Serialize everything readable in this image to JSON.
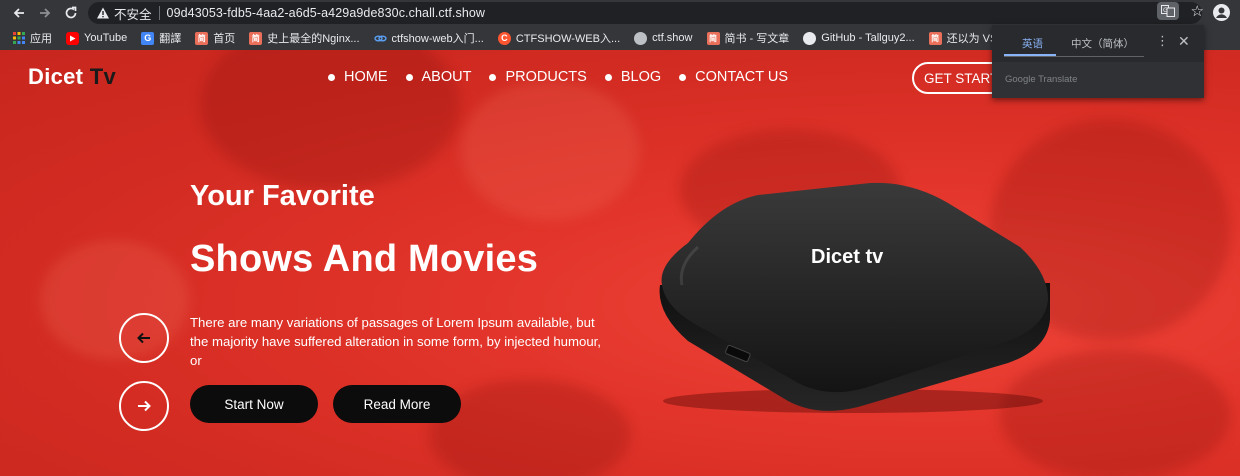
{
  "browser": {
    "insecure_label": "不安全",
    "url": "09d43053-fdb5-4aa2-a6d5-a429a9de830c.chall.ctf.show",
    "bookmarks": [
      {
        "label": "应用",
        "icon": "apps-grid-icon",
        "color": "#4285f4"
      },
      {
        "label": "YouTube",
        "icon": "youtube-icon",
        "color": "#ff0000"
      },
      {
        "label": "翻譯",
        "icon": "translate-icon",
        "color": "#4285f4"
      },
      {
        "label": "首页",
        "icon": "jianshu-icon",
        "color": "#ea6f5a"
      },
      {
        "label": "史上最全的Nginx...",
        "icon": "jianshu-icon",
        "color": "#ea6f5a"
      },
      {
        "label": "ctfshow-web入门...",
        "icon": "link-icon",
        "color": "#5aa0f5"
      },
      {
        "label": "CTFSHOW-WEB入...",
        "icon": "csdn-icon",
        "color": "#fc5531"
      },
      {
        "label": "ctf.show",
        "icon": "globe-icon",
        "color": "#bdc1c6"
      },
      {
        "label": "简书 - 写文章",
        "icon": "jianshu-icon",
        "color": "#ea6f5a"
      },
      {
        "label": "GitHub - Tallguy2...",
        "icon": "github-icon",
        "color": "#e8eaed"
      },
      {
        "label": "还以为 VSCode 是...",
        "icon": "jianshu-icon",
        "color": "#ea6f5a"
      }
    ]
  },
  "translate_popup": {
    "tab_active": "英语",
    "tab_other": "中文（简体）",
    "menu_icon": "more-vert-icon",
    "close_icon": "close-icon",
    "footer": "Google Translate"
  },
  "site": {
    "brand_main": "Dicet ",
    "brand_accent": "Tv",
    "nav": [
      "HOME",
      "ABOUT",
      "PRODUCTS",
      "BLOG",
      "CONTACT US"
    ],
    "cta": "GET STARTED",
    "hero_sub": "Your Favorite",
    "hero_title": "Shows And Movies",
    "hero_text": "There are many variations of passages of Lorem Ipsum available, but the majority have suffered alteration in some form, by injected humour, or",
    "btn_start": "Start Now",
    "btn_more": "Read More",
    "device_label": "Dicet tv",
    "colors": {
      "hero_red": "#e2342a",
      "pill_black": "#0c0c0c",
      "device": "#1e1e1e"
    }
  }
}
